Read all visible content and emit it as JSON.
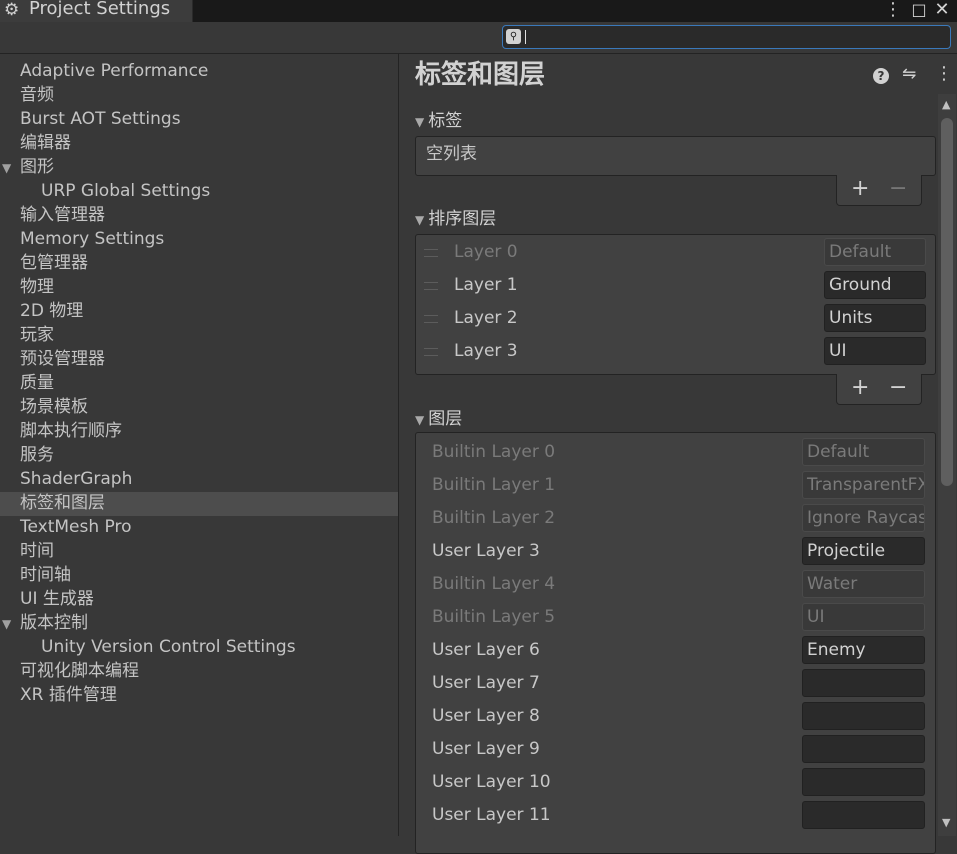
{
  "window": {
    "title": "Project Settings",
    "tab_icon": "gear-icon",
    "menu_glyph": "⋮",
    "maximize_glyph": "□",
    "close_glyph": "✕"
  },
  "search": {
    "value": "",
    "placeholder": "",
    "icon_glyph": "🔍"
  },
  "sidebar": {
    "items": [
      {
        "label": "Adaptive Performance"
      },
      {
        "label": "音频"
      },
      {
        "label": "Burst AOT Settings"
      },
      {
        "label": "编辑器"
      },
      {
        "label": "图形",
        "expanded": true
      },
      {
        "label": "URP Global Settings",
        "child": true
      },
      {
        "label": "输入管理器"
      },
      {
        "label": "Memory Settings"
      },
      {
        "label": "包管理器"
      },
      {
        "label": "物理"
      },
      {
        "label": "2D 物理"
      },
      {
        "label": "玩家"
      },
      {
        "label": "预设管理器"
      },
      {
        "label": "质量"
      },
      {
        "label": "场景模板"
      },
      {
        "label": "脚本执行顺序"
      },
      {
        "label": "服务"
      },
      {
        "label": "ShaderGraph"
      },
      {
        "label": "标签和图层",
        "selected": true
      },
      {
        "label": "TextMesh Pro"
      },
      {
        "label": "时间"
      },
      {
        "label": "时间轴"
      },
      {
        "label": "UI 生成器"
      },
      {
        "label": "版本控制",
        "expanded": true
      },
      {
        "label": "Unity Version Control Settings",
        "child": true
      },
      {
        "label": "可视化脚本编程"
      },
      {
        "label": "XR 插件管理"
      }
    ]
  },
  "main": {
    "title": "标签和图层",
    "help_glyph": "?",
    "preset_glyph": "⇋",
    "more_glyph": "⋮",
    "collapse_glyph": "▼",
    "add_glyph": "+",
    "remove_glyph": "−",
    "tags": {
      "header": "标签",
      "empty_text": "空列表"
    },
    "sorting_layers": {
      "header": "排序图层",
      "rows": [
        {
          "label": "Layer 0",
          "value": "Default",
          "disabled": true
        },
        {
          "label": "Layer 1",
          "value": "Ground",
          "disabled": false
        },
        {
          "label": "Layer 2",
          "value": "Units",
          "disabled": false
        },
        {
          "label": "Layer 3",
          "value": "UI",
          "disabled": false
        }
      ]
    },
    "layers": {
      "header": "图层",
      "rows": [
        {
          "label": "Builtin Layer 0",
          "value": "Default",
          "disabled": true
        },
        {
          "label": "Builtin Layer 1",
          "value": "TransparentFX",
          "disabled": true
        },
        {
          "label": "Builtin Layer 2",
          "value": "Ignore Raycast",
          "disabled": true
        },
        {
          "label": "User Layer 3",
          "value": "Projectile",
          "disabled": false
        },
        {
          "label": "Builtin Layer 4",
          "value": "Water",
          "disabled": true
        },
        {
          "label": "Builtin Layer 5",
          "value": "UI",
          "disabled": true
        },
        {
          "label": "User Layer 6",
          "value": "Enemy",
          "disabled": false
        },
        {
          "label": "User Layer 7",
          "value": "",
          "disabled": false
        },
        {
          "label": "User Layer 8",
          "value": "",
          "disabled": false
        },
        {
          "label": "User Layer 9",
          "value": "",
          "disabled": false
        },
        {
          "label": "User Layer 10",
          "value": "",
          "disabled": false
        },
        {
          "label": "User Layer 11",
          "value": "",
          "disabled": false
        }
      ]
    },
    "scroll_up_glyph": "▲",
    "scroll_down_glyph": "▼"
  },
  "colors": {
    "background": "#383838",
    "titlebar": "#191919",
    "selected_row": "#4d4d4d",
    "search_focus": "#3a79bb",
    "text": "#c4c4c4",
    "field_bg": "#2a2a2a"
  }
}
